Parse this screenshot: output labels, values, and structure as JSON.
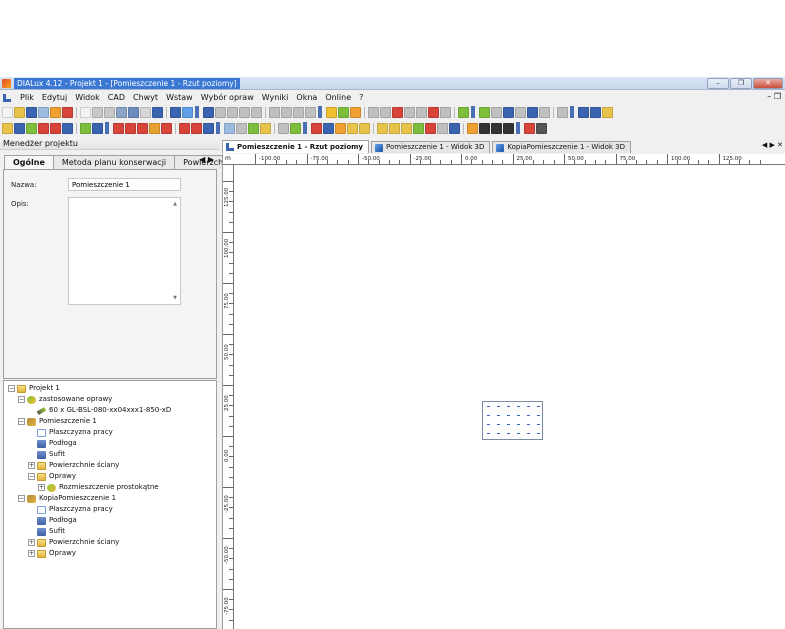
{
  "window": {
    "title": "DIALux 4.12 - Projekt 1 - [Pomieszczenie 1 - Rzut poziomy]",
    "buttons": {
      "minimize": "–",
      "restore": "❐",
      "close": "✕"
    }
  },
  "menu": {
    "items": [
      "Plik",
      "Edytuj",
      "Widok",
      "CAD",
      "Chwyt",
      "Wstaw",
      "Wybór opraw",
      "Wyniki",
      "Okna",
      "Online",
      "?"
    ],
    "right": "– ❐"
  },
  "left_panel": {
    "title": "Menedżer projektu",
    "tabs": [
      "Ogólne",
      "Metoda planu konserwacji",
      "Powierzchnie"
    ],
    "tab_arrows": "◀ ▶",
    "name_label": "Nazwa:",
    "name_value": "Pomieszczenie 1",
    "desc_label": "Opis:",
    "tree": [
      {
        "label": "Projekt 1",
        "icon": "folder-icon",
        "indent": 0,
        "exp": "−"
      },
      {
        "label": "zastosowane oprawy",
        "icon": "luminaire-group-icon",
        "indent": 1,
        "exp": "−"
      },
      {
        "label": "60 x GL-BSL-080-xx04xxx1-850-xD",
        "icon": "lamp-icon",
        "indent": 2,
        "exp": ""
      },
      {
        "label": "Pomieszczenie 1",
        "icon": "room-icon",
        "indent": 1,
        "exp": "−"
      },
      {
        "label": "Płaszczyzna pracy",
        "icon": "workplane-icon",
        "indent": 2,
        "exp": ""
      },
      {
        "label": "Podłoga",
        "icon": "floor-icon",
        "indent": 2,
        "exp": ""
      },
      {
        "label": "Sufit",
        "icon": "ceiling-icon",
        "indent": 2,
        "exp": ""
      },
      {
        "label": "Powierzchnie ściany",
        "icon": "folder-icon",
        "indent": 2,
        "exp": "+"
      },
      {
        "label": "Oprawy",
        "icon": "folder-icon",
        "indent": 2,
        "exp": "−"
      },
      {
        "label": "Rozmieszczenie prostokątne",
        "icon": "arrangement-icon",
        "indent": 3,
        "exp": "+"
      },
      {
        "label": "KopiaPomieszczenie 1",
        "icon": "room-icon",
        "indent": 1,
        "exp": "−"
      },
      {
        "label": "Płaszczyzna pracy",
        "icon": "workplane-icon",
        "indent": 2,
        "exp": ""
      },
      {
        "label": "Podłoga",
        "icon": "floor-icon",
        "indent": 2,
        "exp": ""
      },
      {
        "label": "Sufit",
        "icon": "ceiling-icon",
        "indent": 2,
        "exp": ""
      },
      {
        "label": "Powierzchnie ściany",
        "icon": "folder-icon",
        "indent": 2,
        "exp": "+"
      },
      {
        "label": "Oprawy",
        "icon": "folder-icon",
        "indent": 2,
        "exp": "+"
      }
    ]
  },
  "doc_tabs": [
    {
      "label": "Pomieszczenie 1 - Rzut poziomy",
      "active": true,
      "icon": "floorplan-icon"
    },
    {
      "label": "Pomieszczenie 1 - Widok 3D",
      "active": false,
      "icon": "cube-icon"
    },
    {
      "label": "KopiaPomieszczenie 1 - Widok 3D",
      "active": false,
      "icon": "cube-icon"
    }
  ],
  "doc_tab_arrows": "◀ ▶ ✕",
  "ruler": {
    "unit": "m",
    "h_labels": [
      "-100.00",
      "-75.00",
      "-50.00",
      "-25.00",
      "0.00",
      "25.00",
      "50.00",
      "75.00",
      "100.00",
      "125.00"
    ],
    "v_labels": [
      "125.00",
      "100.00",
      "75.00",
      "50.00",
      "25.00",
      "0.00",
      "-25.00",
      "-50.00",
      "-75.00"
    ]
  },
  "toolbar_colors": {
    "row1": [
      "#f3f3f3",
      "#e8c34a",
      "#3b64b0",
      "#9bbbe0",
      "#f0a030",
      "#d8433a",
      "#f3f3f3",
      "#c7c7c7",
      "#c7c7c7",
      "#8aa4c8",
      "#6c8cc0",
      "#d6d6d6",
      "#3b64b0",
      "#3b64b0",
      "#5fa0e8",
      "#3b64b0",
      "#c0c0c0",
      "#c0c0c0",
      "#c0c0c0",
      "#c0c0c0",
      "#c0c0c0",
      "#c0c0c0",
      "#c0c0c0",
      "#c0c0c0",
      "#f0c030",
      "#7dbf3c",
      "#f0a030",
      "#c0c0c0",
      "#c0c0c0",
      "#d8433a",
      "#c0c0c0",
      "#c0c0c0",
      "#d8433a",
      "#c0c0c0",
      "#7dbf3c",
      "#7dbf3c",
      "#c0c0c0",
      "#3b64b0",
      "#c0c0c0",
      "#3b64b0",
      "#c0c0c0",
      "#c0c0c0",
      "#3b64b0",
      "#3b64b0",
      "#e8c34a"
    ],
    "row2": [
      "#e8c34a",
      "#3b64b0",
      "#7dbf3c",
      "#d8433a",
      "#d8433a",
      "#3b64b0",
      "#7dbf3c",
      "#3b64b0",
      "#d8433a",
      "#d8433a",
      "#d8433a",
      "#e8a030",
      "#d8433a",
      "#d8433a",
      "#d8433a",
      "#3b64b0",
      "#9bbbe0",
      "#c0c0c0",
      "#7dbf3c",
      "#e8c34a",
      "#c0c0c0",
      "#7dbf3c",
      "#d8433a",
      "#3b64b0",
      "#f0a030",
      "#e8c34a",
      "#e8c34a",
      "#e8c34a",
      "#e8c34a",
      "#e8c34a",
      "#7dbf3c",
      "#d8433a",
      "#c0c0c0",
      "#3b64b0",
      "#f0a030",
      "#333333",
      "#333333",
      "#333333",
      "#d8433a",
      "#555555"
    ]
  }
}
